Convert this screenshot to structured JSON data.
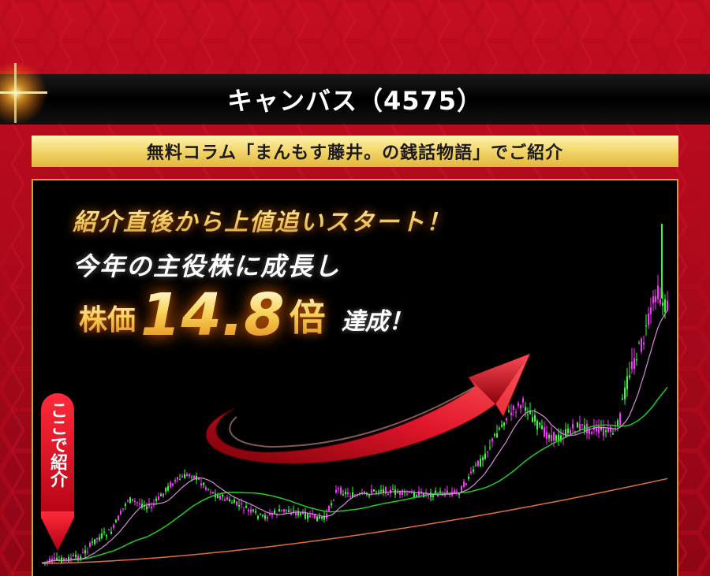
{
  "header": {
    "title": "キャンバス（4575）"
  },
  "subheader": {
    "text": "無料コラム「まんもす藤井。の銭話物語」でご紹介"
  },
  "chart_panel": {
    "headline_1": "紹介直後から上値追いスタート！",
    "headline_2": "今年の主役株に成長し",
    "headline_3_prefix": "株価",
    "headline_3_number": "14.8",
    "headline_3_unit": "倍",
    "headline_3_suffix": "達成！",
    "badge_text": "ここで紹介"
  },
  "colors": {
    "background_red": "#a8071a",
    "gold": "#c9a23c",
    "up_candle": "#ff33ff",
    "down_candle": "#33ff33",
    "ma_short": "#e68ae6",
    "ma_mid": "#22cc22",
    "ma_long": "#e0703a",
    "arrow_red": "#d41020"
  },
  "icons": {
    "badge_arrow": "down-arrow-icon",
    "trend_arrow": "curved-up-arrow-icon"
  }
}
